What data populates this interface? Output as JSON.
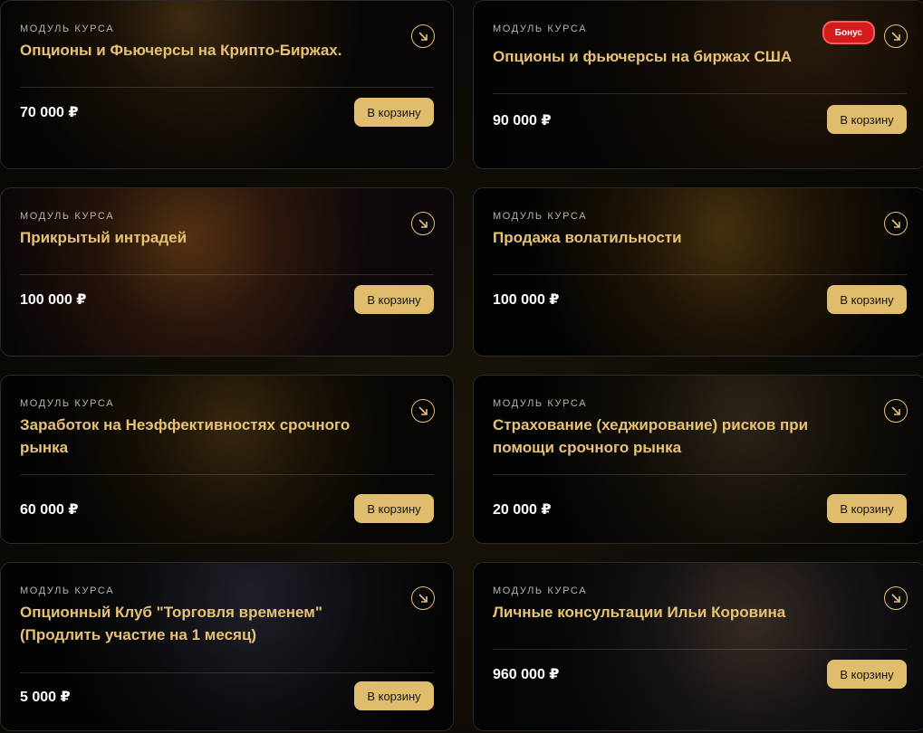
{
  "cards": [
    {
      "eyebrow": "МОДУЛЬ КУРСА",
      "title": "Опционы и Фьючерсы на Крипто-Биржах.",
      "price": "70 000 ₽",
      "button": "В корзину"
    },
    {
      "eyebrow": "МОДУЛЬ КУРСА",
      "title": "Опционы и фьючерсы на биржах США",
      "price": "90 000 ₽",
      "button": "В корзину",
      "badge": "Бонус"
    },
    {
      "eyebrow": "МОДУЛЬ КУРСА",
      "title": "Прикрытый интрадей",
      "price": "100 000 ₽",
      "button": "В корзину"
    },
    {
      "eyebrow": "МОДУЛЬ КУРСА",
      "title": "Продажа волатильности",
      "price": "100 000 ₽",
      "button": "В корзину"
    },
    {
      "eyebrow": "МОДУЛЬ КУРСА",
      "title": "Заработок на Неэффективностях срочного рынка",
      "price": "60 000 ₽",
      "button": "В корзину"
    },
    {
      "eyebrow": "МОДУЛЬ КУРСА",
      "title": "Страхование (хеджирование) рисков при помощи срочного рынка",
      "price": "20 000 ₽",
      "button": "В корзину"
    },
    {
      "eyebrow": "МОДУЛЬ КУРСА",
      "title": "Опционный Клуб \"Торговля временем\" (Продлить участие на 1 месяц)",
      "price": "5 000 ₽",
      "button": "В корзину"
    },
    {
      "eyebrow": "МОДУЛЬ КУРСА",
      "title": "Личные консультации Ильи Коровина",
      "price": "960 000 ₽",
      "button": "В корзину"
    }
  ],
  "colors": {
    "accent": "#dfbd6c",
    "title": "#e7c272",
    "badge": "#d31b1b"
  },
  "icons": {
    "arrow": "arrow-down-right-icon"
  }
}
